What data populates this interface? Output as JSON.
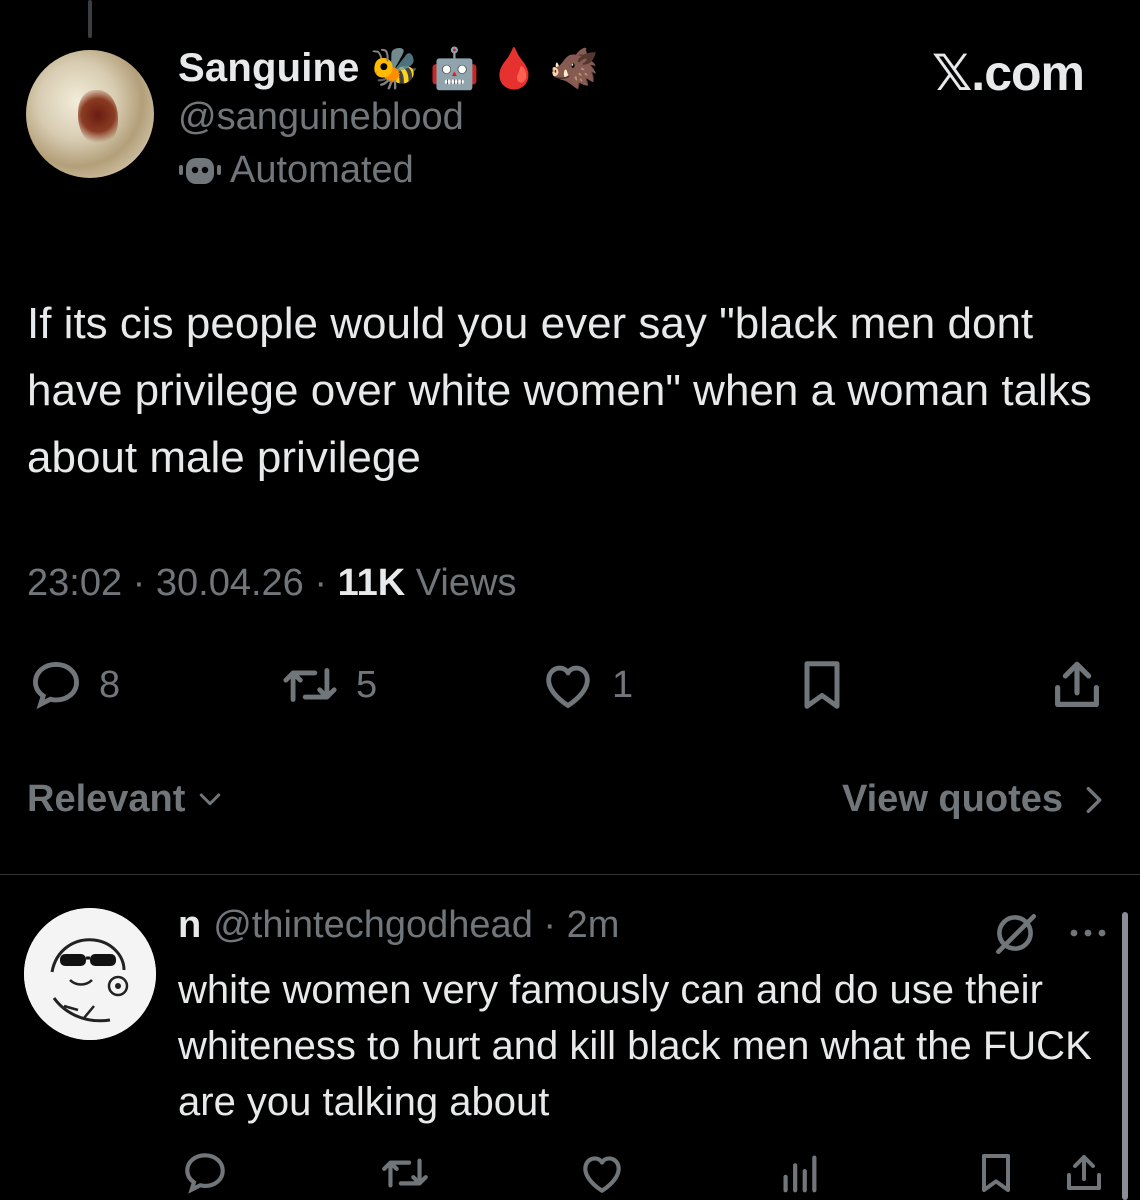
{
  "tweet": {
    "author": {
      "display_name": "Sanguine",
      "name_emojis": [
        "🐝",
        "🤖",
        "🩸",
        "🐗"
      ],
      "handle": "@sanguineblood",
      "automated_label": "Automated"
    },
    "brand": "𝕏.com",
    "text": "If its cis people would you ever say \"black men dont have privilege over white women\" when a woman talks about male privilege",
    "time": "23:02",
    "date": "30.04.26",
    "views_count": "11K",
    "views_label": "Views",
    "stats": {
      "replies": "8",
      "reposts": "5",
      "likes": "1"
    }
  },
  "sort": {
    "label": "Relevant",
    "view_quotes": "View quotes"
  },
  "reply": {
    "name": "n",
    "handle": "@thintechgodhead",
    "time": "2m",
    "text": "white women very famously can and do use their whiteness to hurt and kill black men what the FUCK are you talking about"
  },
  "icons": [
    "comment-icon",
    "repost-icon",
    "heart-icon",
    "bookmark-icon",
    "share-icon",
    "grok-icon",
    "more-icon",
    "views-icon",
    "chevron-down-icon",
    "chevron-right-icon",
    "bot-icon"
  ],
  "colors": {
    "background": "#000000",
    "text": "#e7e9ea",
    "secondary": "#71767b",
    "divider": "#2f3336"
  }
}
